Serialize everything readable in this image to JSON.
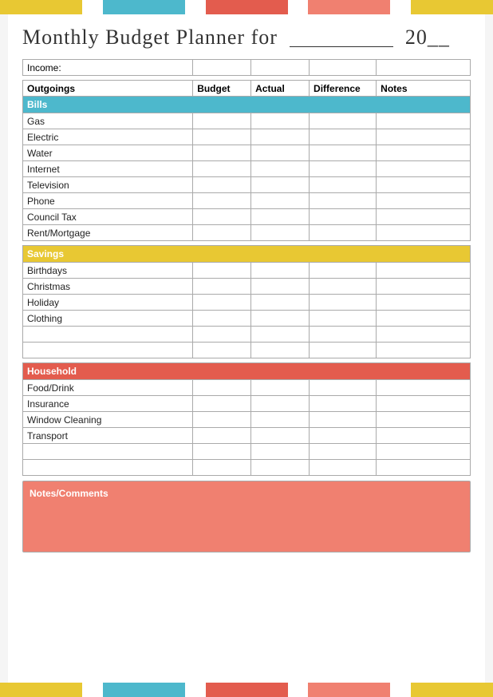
{
  "topBar": [
    {
      "color": "#e8c833",
      "flex": 2
    },
    {
      "color": "#fff",
      "flex": 0.5
    },
    {
      "color": "#4db8cc",
      "flex": 2
    },
    {
      "color": "#fff",
      "flex": 0.5
    },
    {
      "color": "#e35c4e",
      "flex": 2
    },
    {
      "color": "#fff",
      "flex": 0.5
    },
    {
      "color": "#f08070",
      "flex": 2
    },
    {
      "color": "#fff",
      "flex": 0.5
    },
    {
      "color": "#e8c833",
      "flex": 2
    }
  ],
  "bottomBar": [
    {
      "color": "#e8c833",
      "flex": 2
    },
    {
      "color": "#fff",
      "flex": 0.5
    },
    {
      "color": "#4db8cc",
      "flex": 2
    },
    {
      "color": "#fff",
      "flex": 0.5
    },
    {
      "color": "#e35c4e",
      "flex": 2
    },
    {
      "color": "#fff",
      "flex": 0.5
    },
    {
      "color": "#f08070",
      "flex": 2
    },
    {
      "color": "#fff",
      "flex": 0.5
    },
    {
      "color": "#e8c833",
      "flex": 2
    }
  ],
  "title": "Monthly Budget Planner for",
  "title_year_prefix": "20",
  "columns": {
    "outgoings": "Outgoings",
    "budget": "Budget",
    "actual": "Actual",
    "difference": "Difference",
    "notes": "Notes"
  },
  "income_label": "Income:",
  "bills": {
    "label": "Bills",
    "items": [
      "Gas",
      "Electric",
      "Water",
      "Internet",
      "Television",
      "Phone",
      "Council Tax",
      "Rent/Mortgage"
    ]
  },
  "savings": {
    "label": "Savings",
    "items": [
      "Birthdays",
      "Christmas",
      "Holiday",
      "Clothing"
    ]
  },
  "household": {
    "label": "Household",
    "items": [
      "Food/Drink",
      "Insurance",
      "Window Cleaning",
      "Transport"
    ]
  },
  "notes_label": "Notes/Comments"
}
